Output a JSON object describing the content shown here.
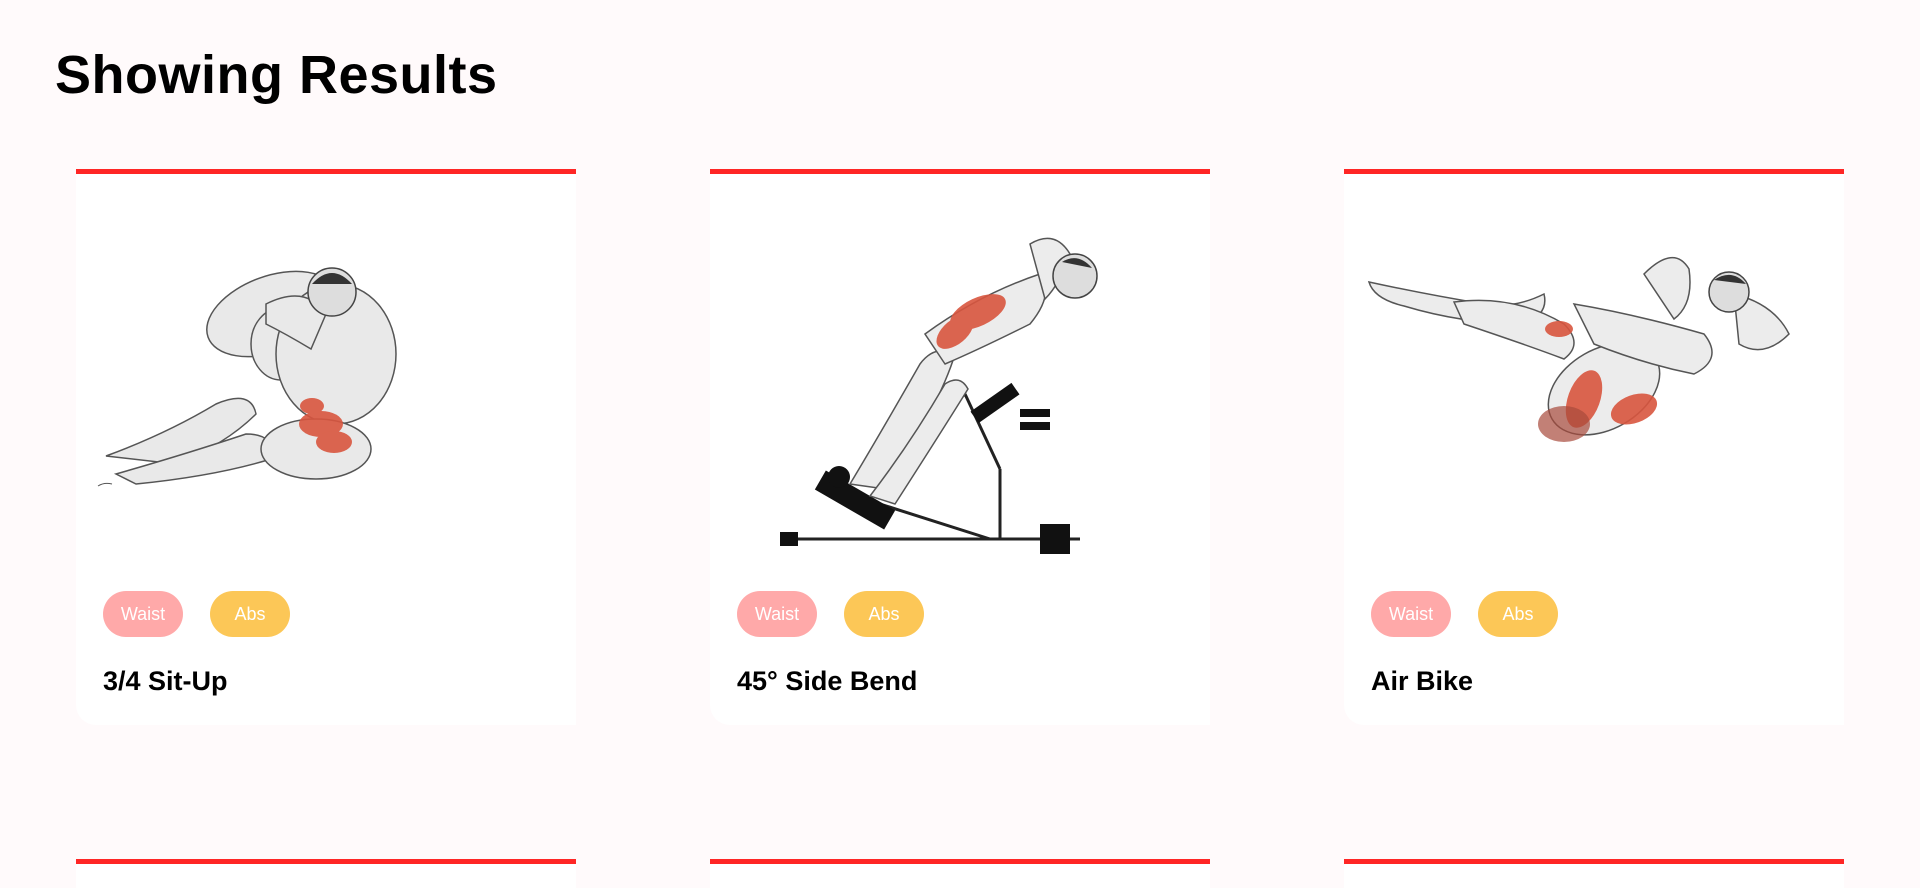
{
  "heading": "Showing Results",
  "colors": {
    "accent": "#ff2625",
    "waist_pill": "#ffa9a9",
    "abs_pill": "#fcc757",
    "background": "#fffafb"
  },
  "exercises": [
    {
      "name": "3/4 Sit-Up",
      "tags": [
        "Waist",
        "Abs"
      ],
      "image": "sit-up-illustration"
    },
    {
      "name": "45° Side Bend",
      "tags": [
        "Waist",
        "Abs"
      ],
      "image": "side-bend-bench-illustration"
    },
    {
      "name": "Air Bike",
      "tags": [
        "Waist",
        "Abs"
      ],
      "image": "air-bike-illustration"
    }
  ]
}
